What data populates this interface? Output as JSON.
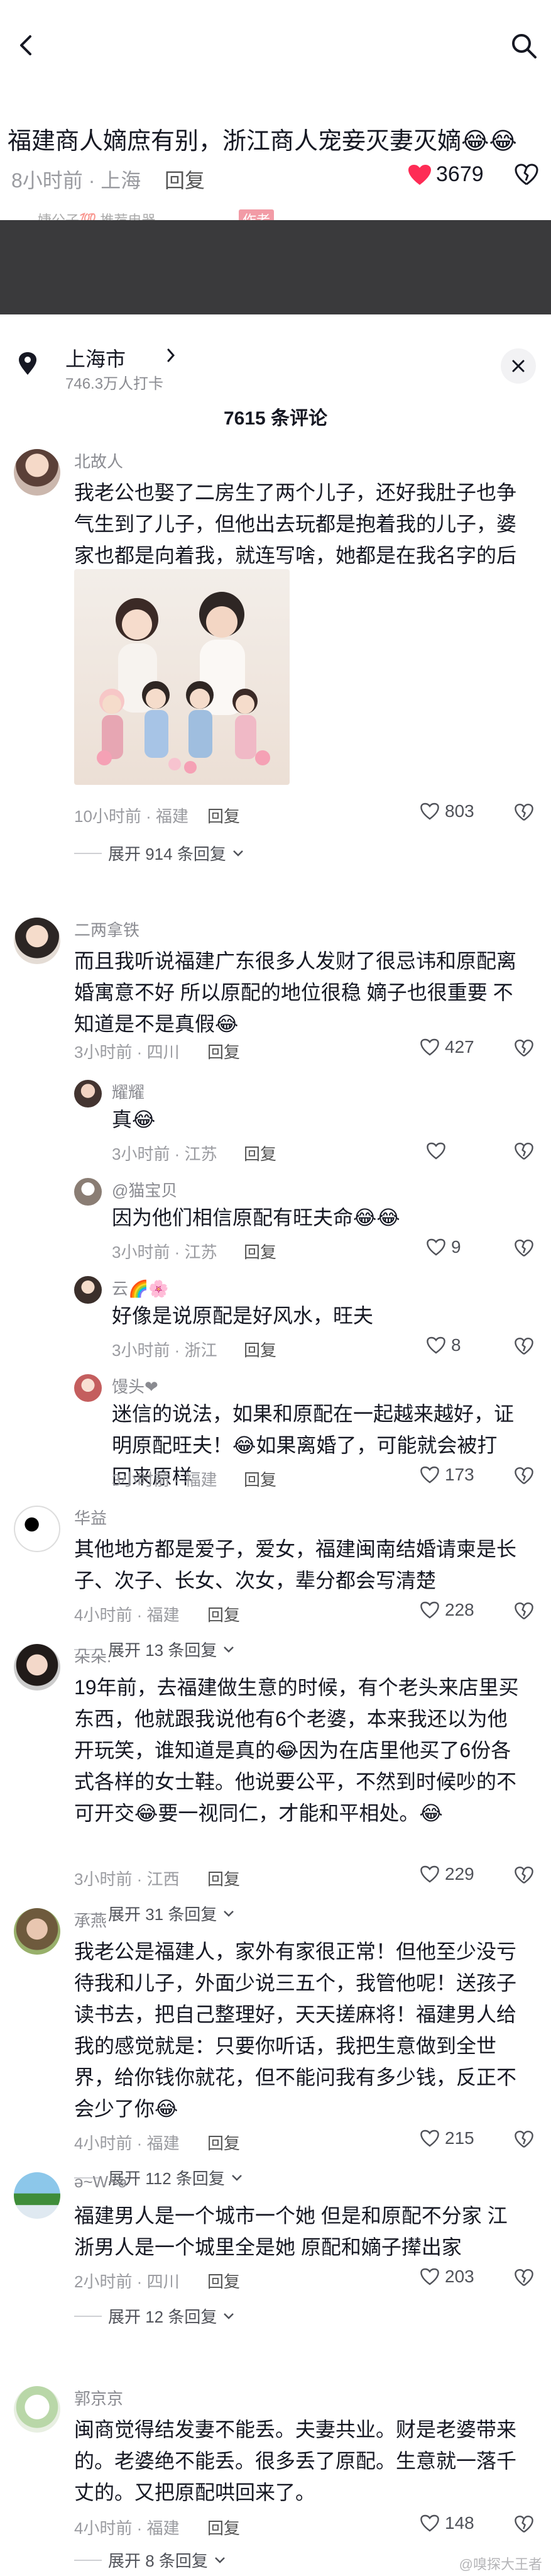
{
  "post": {
    "title": "福建商人嫡庶有别，浙江商人宠妾灭妻灭嫡😂😂",
    "meta": "8小时前 · 上海",
    "reply": "回复",
    "likes": "3679",
    "next_author": "婕公子💯 推荐电器",
    "author_tag": "作者"
  },
  "sheet": {
    "location": "上海市",
    "location_sub": "746.3万人打卡",
    "comment_count": "7615 条评论"
  },
  "comments": [
    {
      "name": "北故人",
      "text": "我老公也娶了二房生了两个儿子，还好我肚子也争气生到了儿子，但他出去玩都是抱着我的儿子，婆家也都是向着我，就连写啥，她都是在我名字的后面括号里🤔🤔🤔",
      "meta": "10小时前 · 福建",
      "reply": "回复",
      "likes": "803",
      "expand": "展开 914 条回复"
    },
    {
      "name": "二两拿铁",
      "text": "而且我听说福建广东很多人发财了很忌讳和原配离婚寓意不好 所以原配的地位很稳 嫡子也很重要 不知道是不是真假😂",
      "meta": "3小时前 · 四川",
      "reply": "回复",
      "likes": "427",
      "replies": [
        {
          "name": "耀耀",
          "text": "真😂",
          "meta": "3小时前 · 江苏",
          "reply": "回复",
          "likes": ""
        },
        {
          "name": "@猫宝贝",
          "text": "因为他们相信原配有旺夫命😂😂",
          "meta": "3小时前 · 江苏",
          "reply": "回复",
          "likes": "9"
        },
        {
          "name": "云🌈🌸",
          "text": "好像是说原配是好风水，旺夫",
          "meta": "3小时前 · 浙江",
          "reply": "回复",
          "likes": "8"
        },
        {
          "name": "馒头❤",
          "text": "迷信的说法，如果和原配在一起越来越好，证明原配旺夫！😂如果离婚了，可能就会被打回来原样",
          "meta": "3小时前 · 福建",
          "reply": "回复",
          "likes": "173"
        }
      ]
    },
    {
      "name": "华益",
      "text": "其他地方都是爱子，爱女，福建闽南结婚请柬是长子、次子、长女、次女，辈分都会写清楚",
      "meta": "4小时前 · 福建",
      "reply": "回复",
      "likes": "228",
      "expand": "展开 13 条回复"
    },
    {
      "name": "朵朵.",
      "text": "19年前，去福建做生意的时候，有个老头来店里买东西，他就跟我说他有6个老婆，本来我还以为他开玩笑，谁知道是真的😂因为在店里他买了6份各式各样的女士鞋。他说要公平，不然到时候吵的不可开交😂要一视同仁，才能和平相处。😂",
      "meta": "3小时前 · 江西",
      "reply": "回复",
      "likes": "229",
      "expand": "展开 31 条回复"
    },
    {
      "name": "承燕",
      "text": "我老公是福建人，家外有家很正常！但他至少没亏待我和儿子，外面少说三五个，我管他呢！送孩子读书去，把自己整理好，天天搓麻将！福建男人给我的感觉就是：只要你听话，我把生意做到全世界，给你钱你就花，但不能问我有多少钱，反正不会少了你😂",
      "meta": "4小时前 · 福建",
      "reply": "回复",
      "likes": "215",
      "expand": "展开 112 条回复"
    },
    {
      "name": "ə~W~ə",
      "text": "福建男人是一个城市一个她 但是和原配不分家 江浙男人是一个城里全是她 原配和嫡子撵出家",
      "meta": "2小时前 · 四川",
      "reply": "回复",
      "likes": "203",
      "expand": "展开 12 条回复"
    },
    {
      "name": "郭京京",
      "text": "闽商觉得结发妻不能丢。夫妻共业。财是老婆带来的。老婆绝不能丢。很多丢了原配。生意就一落千丈的。又把原配哄回来了。",
      "meta": "4小时前 · 福建",
      "reply": "回复",
      "likes": "148",
      "expand": "展开 8 条回复"
    }
  ],
  "watermark": "@嗅探大王者",
  "colors": {
    "like_red": "#fe2c55",
    "sheet_bg": "#ffffff",
    "dim": "#3a3a3c",
    "text_main": "#161823",
    "text_sub": "#8a8b91"
  }
}
